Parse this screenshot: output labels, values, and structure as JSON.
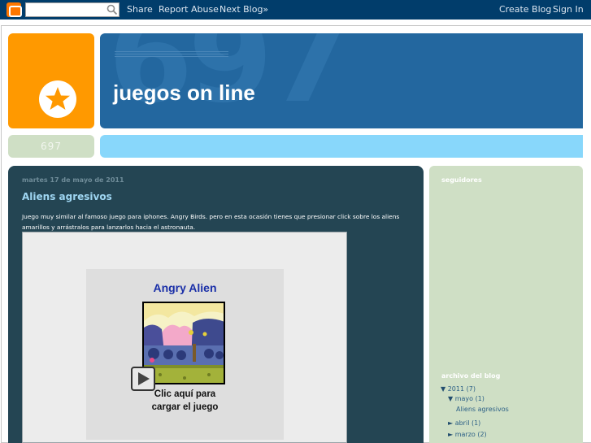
{
  "navbar": {
    "search_placeholder": "",
    "share_label": "Share",
    "report_label": "Report Abuse",
    "next_blog_label": "Next Blog»",
    "create_blog_label": "Create Blog",
    "sign_in_label": "Sign In"
  },
  "header": {
    "blog_title": "juegos on line",
    "watermark": "697",
    "counter": "697"
  },
  "post": {
    "date": "martes 17 de mayo de 2011",
    "title": "Aliens agresivos",
    "body_line1": "Juego muy similar al famoso juego para iphones. Angry Birds. pero en esta ocasión tienes que presionar click sobre los aliens",
    "body_line2": "amarillos y arrástralos para lanzarlos hacia el astronauta.",
    "game_title": "Angry Alien",
    "game_cta_line1": "Clic aquí para",
    "game_cta_line2": "cargar el juego"
  },
  "sidebar": {
    "followers_heading": "seguidores",
    "archive_heading": "archivo del blog",
    "archive": [
      {
        "toggle": "▼",
        "label": "2011",
        "count": "(7)"
      },
      {
        "toggle": "▼",
        "label": "mayo",
        "count": "(1)"
      },
      {
        "label": "Aliens agresivos"
      },
      {
        "toggle": "►",
        "label": "abril",
        "count": "(1)"
      },
      {
        "toggle": "►",
        "label": "marzo",
        "count": "(2)"
      }
    ]
  },
  "colors": {
    "navbar": "#013d6b",
    "logo_orange": "#ff9900",
    "header_blue": "#23679f",
    "bar_light_blue": "#88d7fb",
    "sidebar_green": "#cfdfc5",
    "post_bg": "#244553"
  },
  "icons": {
    "blogger": "blogger-icon",
    "search": "search-icon",
    "star": "star-icon",
    "play": "play-icon"
  }
}
